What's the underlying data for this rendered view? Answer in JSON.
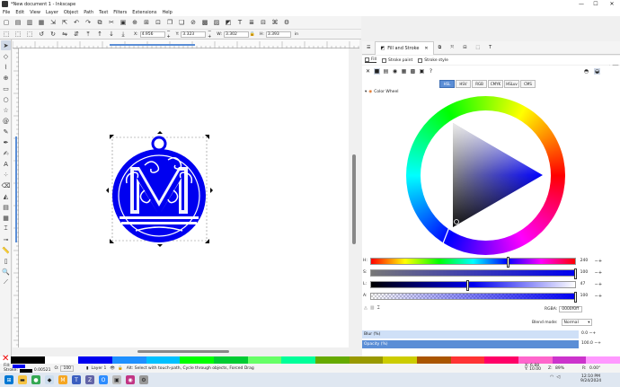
{
  "window": {
    "title": "*New document 1 - Inkscape",
    "controls": [
      "—",
      "☐",
      "✕"
    ]
  },
  "menu": [
    "File",
    "Edit",
    "View",
    "Layer",
    "Object",
    "Path",
    "Text",
    "Filters",
    "Extensions",
    "Help"
  ],
  "command_icons": [
    "document-new-icon",
    "open-icon",
    "save-icon",
    "print-icon",
    "import-icon",
    "export-icon",
    "undo-icon",
    "redo-icon",
    "copy-icon",
    "cut-icon",
    "paste-icon",
    "zoom-selection-icon",
    "zoom-drawing-icon",
    "zoom-page-icon",
    "duplicate-icon",
    "clone-icon",
    "unlink-clone-icon",
    "group-icon",
    "ungroup-icon",
    "fill-stroke-icon",
    "text-font-icon",
    "layers-icon",
    "align-icon",
    "xml-editor-icon",
    "preferences-icon"
  ],
  "controls_bar": {
    "x_label": "X:",
    "x_value": "4.956",
    "y_label": "Y:",
    "y_value": "3.323",
    "w_label": "W:",
    "w_value": "3.302",
    "h_label": "H:",
    "h_value": "3.393",
    "unit": "in"
  },
  "tools": [
    "selector-tool-icon",
    "node-tool-icon",
    "tweak-tool-icon",
    "zoom-tool-icon",
    "measure-tool-icon",
    "rectangle-tool-icon",
    "box3d-tool-icon",
    "ellipse-tool-icon",
    "star-tool-icon",
    "spiral-tool-icon",
    "pencil-tool-icon",
    "pen-tool-icon",
    "calligraphy-tool-icon",
    "text-tool-icon",
    "spray-tool-icon",
    "eraser-tool-icon",
    "bucket-tool-icon",
    "gradient-tool-icon",
    "mesh-tool-icon",
    "dropper-tool-icon",
    "connector-tool-icon",
    "pages-tool-icon",
    "zoom-icon",
    "lpe-tool-icon"
  ],
  "dialog": {
    "tab_active": "Fill and Stroke",
    "subtabs": [
      "Fill",
      "Stroke paint",
      "Stroke style"
    ],
    "color_modes": [
      "HSL",
      "HSV",
      "RGB",
      "CMYK",
      "HSLuv",
      "CMS"
    ],
    "active_mode": "HSL",
    "wheel_label": "Color Wheel",
    "sliders": [
      {
        "label": "H:",
        "value": "240",
        "fraction": 0.667
      },
      {
        "label": "S:",
        "value": "100",
        "fraction": 1.0
      },
      {
        "label": "L:",
        "value": "47",
        "fraction": 0.47
      },
      {
        "label": "A:",
        "value": "100",
        "fraction": 1.0
      }
    ],
    "rgba_label": "RGBA:",
    "rgba_value": "0000f0ff",
    "blend_label": "Blend mode:",
    "blend_value": "Normal",
    "blur_label": "Blur (%)",
    "blur_value": "0.0",
    "opacity_label": "Opacity (%)",
    "opacity_value": "100.0"
  },
  "colors": {
    "accent": "#5b8ed6",
    "object_fill": "#0000f0"
  },
  "palette": [
    "#000000",
    "#ffffff",
    "#0000f0",
    "#1e90ff",
    "#00c0ff",
    "#00ff00",
    "#00cc33",
    "#66ff66",
    "#00ff99",
    "#66aa00",
    "#999900",
    "#cccc00",
    "#aa5500",
    "#ff3333",
    "#ff0066",
    "#ff66cc",
    "#cc33cc",
    "#ff99ff"
  ],
  "status": {
    "fill_label": "Fill:",
    "stroke_label": "Stroke:",
    "stroke_width": "0.00521",
    "opacity_label": "O:",
    "opacity_value": "100",
    "layer": "Layer 1",
    "message": "Alt: Select with touch-path, Cycle through objects, Forced Drag",
    "x_label": "X:",
    "x_value": "6.88",
    "y_label": "Y:",
    "y_value": "10.00",
    "zoom_label": "Z:",
    "zoom_value": "89%",
    "rotation_label": "R:",
    "rotation_value": "0.00°"
  },
  "taskbar": {
    "time": "12:10 PM",
    "date": "9/24/2024"
  }
}
